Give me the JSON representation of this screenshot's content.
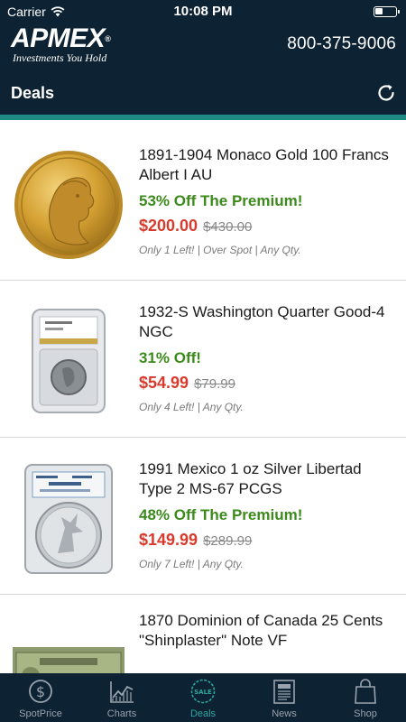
{
  "status_bar": {
    "carrier": "Carrier",
    "time": "10:08 PM"
  },
  "header": {
    "logo_text": "APMEX",
    "logo_tagline": "Investments You Hold",
    "phone": "800-375-9006",
    "title": "Deals"
  },
  "deals": [
    {
      "title": "1891-1904 Monaco Gold 100 Francs Albert I AU",
      "promo": "53% Off The Premium!",
      "price": "$200.00",
      "was_price": "$430.00",
      "note": "Only 1 Left! | Over Spot | Any Qty."
    },
    {
      "title": "1932-S Washington Quarter Good-4 NGC",
      "promo": "31% Off!",
      "price": "$54.99",
      "was_price": "$79.99",
      "note": "Only 4 Left! | Any Qty."
    },
    {
      "title": "1991 Mexico 1 oz Silver Libertad Type 2 MS-67 PCGS",
      "promo": "48% Off The Premium!",
      "price": "$149.99",
      "was_price": "$289.99",
      "note": "Only 7 Left! | Any Qty."
    },
    {
      "title": "1870 Dominion of Canada 25 Cents \"Shinplaster\" Note VF",
      "promo": "",
      "price": "",
      "was_price": "",
      "note": ""
    }
  ],
  "tabs": [
    {
      "label": "SpotPrice",
      "icon": "dollar-coin-icon"
    },
    {
      "label": "Charts",
      "icon": "chart-icon"
    },
    {
      "label": "Deals",
      "icon": "sale-badge-icon",
      "active": true
    },
    {
      "label": "News",
      "icon": "newspaper-icon"
    },
    {
      "label": "Shop",
      "icon": "shopping-bag-icon"
    }
  ],
  "colors": {
    "header_bg": "#0d2233",
    "accent_teal": "#1e8a84",
    "promo_green": "#3c8a1c",
    "price_red": "#d93a2b"
  }
}
